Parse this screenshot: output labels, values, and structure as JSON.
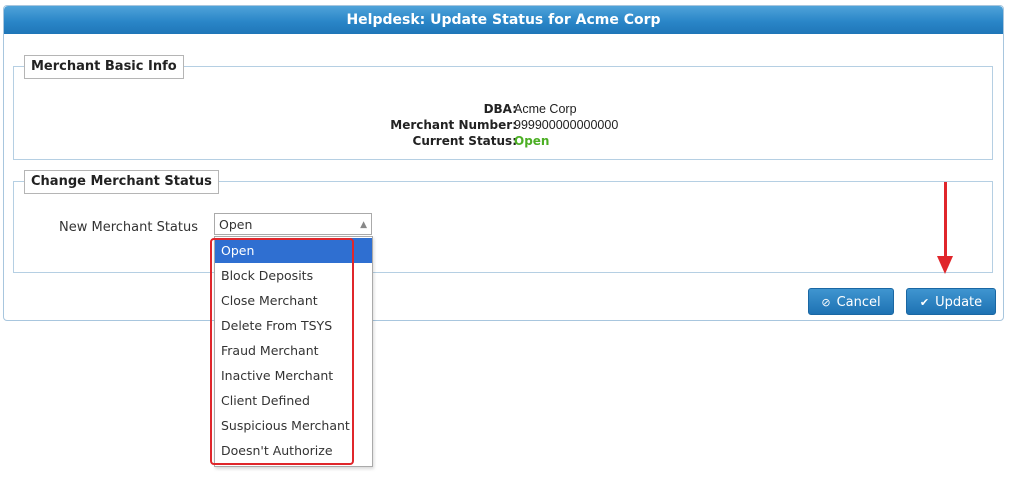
{
  "dialog": {
    "title": "Helpdesk: Update Status for Acme Corp"
  },
  "basic_info": {
    "legend": "Merchant Basic Info",
    "rows": [
      {
        "label": "DBA:",
        "value": "Acme Corp"
      },
      {
        "label": "Merchant Number:",
        "value": "999900000000000"
      },
      {
        "label": "Current Status:",
        "value": "Open"
      }
    ]
  },
  "change_status": {
    "legend": "Change Merchant Status",
    "field_label": "New Merchant Status",
    "selected_value": "Open",
    "options": [
      "Open",
      "Block Deposits",
      "Close Merchant",
      "Delete From TSYS",
      "Fraud Merchant",
      "Inactive Merchant",
      "Client Defined",
      "Suspicious Merchant",
      "Doesn't Authorize"
    ]
  },
  "buttons": {
    "cancel_label": "Cancel",
    "update_label": "Update"
  },
  "icons": {
    "cancel": "ban-icon",
    "update": "check-icon",
    "select_arrow": "triangle-up-icon"
  },
  "colors": {
    "title_bar": "#2a86c8",
    "status_open": "#4caf24",
    "selected_option": "#2f6fd1",
    "annotation": "#e0262b"
  }
}
